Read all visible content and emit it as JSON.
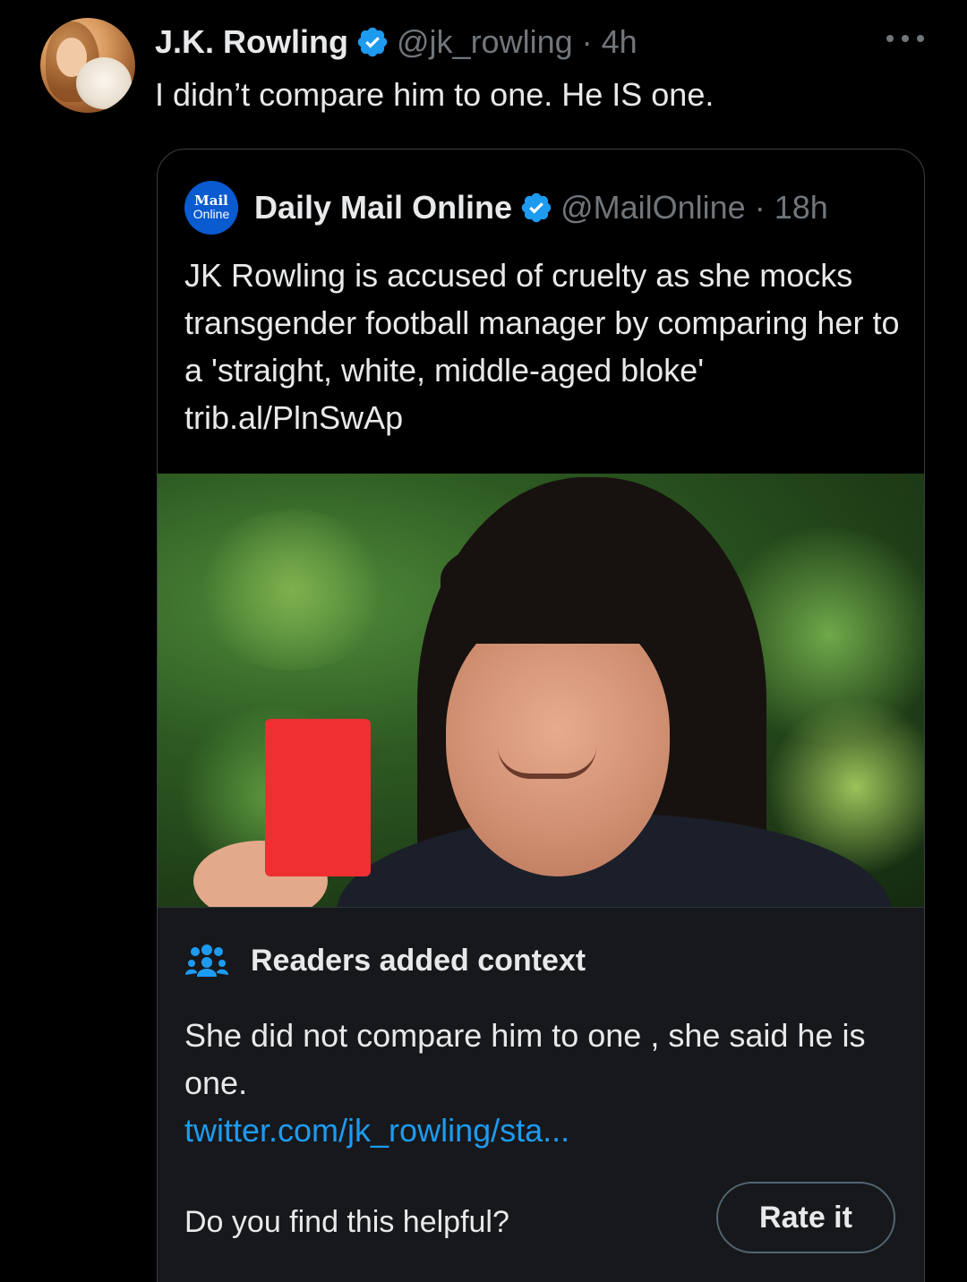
{
  "tweet": {
    "author_name": "J.K. Rowling",
    "author_handle": "@jk_rowling",
    "separator": "·",
    "time": "4h",
    "text": "I didn’t compare him to one. He IS one.",
    "avatar_icon": "profile-photo-with-dog",
    "verified_icon": "verified-badge-icon",
    "more_icon": "more-options-icon"
  },
  "quote": {
    "logo_line1": "Mail",
    "logo_line2": "Online",
    "author_name": "Daily Mail Online",
    "author_handle": "@MailOnline",
    "separator": "·",
    "time": "18h",
    "text": "JK Rowling is accused of cruelty as she mocks transgender football manager by comparing her to a 'straight, white, middle-aged bloke' trib.al/PlnSwAp",
    "media_icon": "news-photo-person-holding-red-card"
  },
  "community_note": {
    "heading": "Readers added context",
    "icon": "people-group-icon",
    "text": "She did not compare him to one , she said he is one.",
    "link": "twitter.com/jk_rowling/sta...",
    "prompt": "Do you find this helpful?",
    "rate_label": "Rate it"
  },
  "colors": {
    "background": "#000000",
    "text_primary": "#e7e9ea",
    "text_muted": "#71767b",
    "verified_blue": "#1d9bf0",
    "link_blue": "#1d9bf0",
    "notes_background": "#16181c",
    "border": "#3a3f44"
  }
}
